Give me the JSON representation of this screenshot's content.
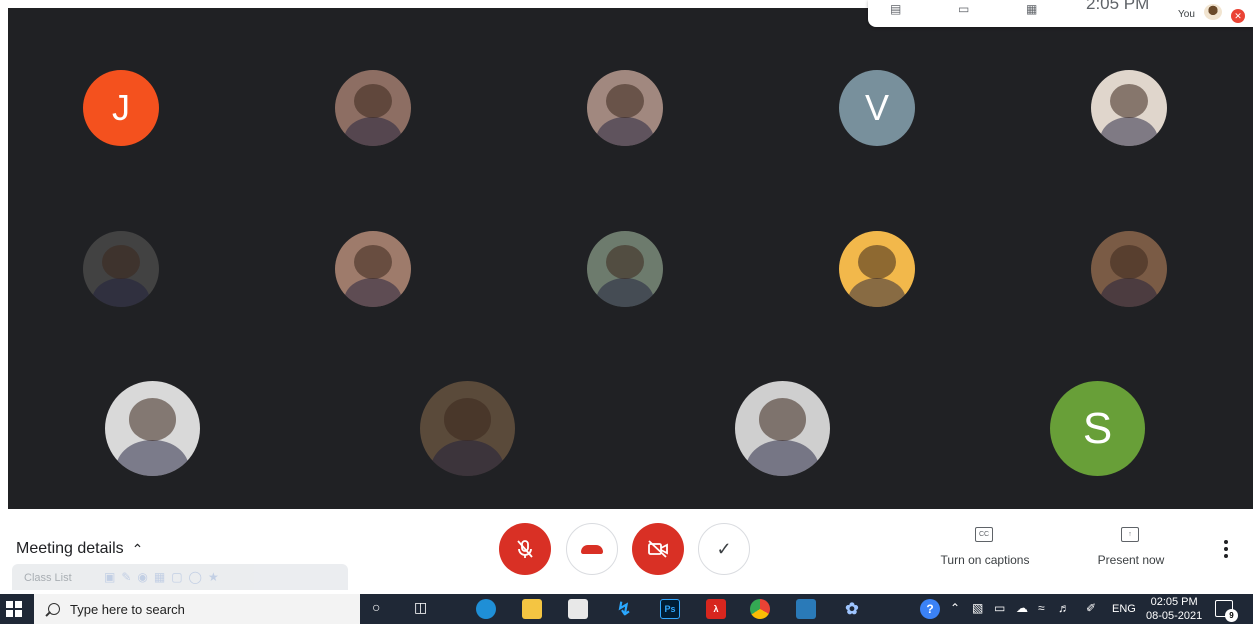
{
  "topbar": {
    "time": "2:05 PM",
    "you_label": "You"
  },
  "participants": [
    {
      "letter": "J",
      "color": "#f4511e",
      "kind": "letter"
    },
    {
      "kind": "photo",
      "tone": "#8d6e63"
    },
    {
      "kind": "photo",
      "tone": "#a1887f"
    },
    {
      "letter": "V",
      "color": "#78909c",
      "kind": "letter"
    },
    {
      "kind": "photo",
      "tone": "#e0d6cc"
    },
    {
      "kind": "photo",
      "tone": "#424242"
    },
    {
      "kind": "photo",
      "tone": "#9e7b6b"
    },
    {
      "kind": "photo",
      "tone": "#6d7b6d"
    },
    {
      "kind": "photo",
      "tone": "#f2b84b"
    },
    {
      "kind": "photo",
      "tone": "#7a5b45"
    },
    {
      "kind": "photo",
      "tone": "#d9d9d9"
    },
    {
      "kind": "photo",
      "tone": "#5a4a3a"
    },
    {
      "kind": "photo",
      "tone": "#cfcfcf"
    },
    {
      "letter": "S",
      "color": "#689f38",
      "kind": "letter"
    }
  ],
  "controls": {
    "meeting_details": "Meeting details",
    "class_list": "Class List",
    "captions_label": "Turn on captions",
    "captions_icon_text": "CC",
    "present_label": "Present now"
  },
  "taskbar": {
    "search_placeholder": "Type here to search",
    "language": "ENG",
    "clock_time": "02:05 PM",
    "clock_date": "08-05-2021",
    "notification_count": "9",
    "ps_label": "Ps"
  }
}
